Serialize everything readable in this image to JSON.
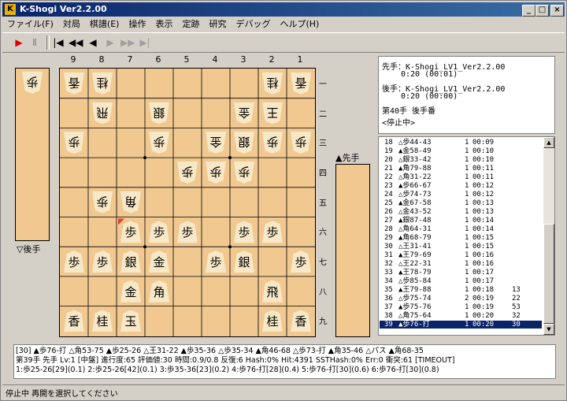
{
  "window": {
    "title": "K-Shogi Ver2.2.00",
    "min": "_",
    "max": "□",
    "close": "×"
  },
  "menu": [
    "ファイル(F)",
    "対局",
    "棋譜(E)",
    "操作",
    "表示",
    "定跡",
    "研究",
    "デバッグ",
    "ヘルプ(H)"
  ],
  "toolbar": {
    "play": "▶",
    "pause": "Ⅱ",
    "first": "|◀",
    "back10": "◀◀",
    "back": "◀",
    "forward": "▶",
    "fwd10": "▶▶",
    "last": "▶|"
  },
  "board": {
    "columns": [
      "9",
      "8",
      "7",
      "6",
      "5",
      "4",
      "3",
      "2",
      "1"
    ],
    "rows": [
      "一",
      "二",
      "三",
      "四",
      "五",
      "六",
      "七",
      "八",
      "九"
    ],
    "pieces": [
      {
        "c": 0,
        "r": 0,
        "p": "香",
        "s": "gote"
      },
      {
        "c": 1,
        "r": 0,
        "p": "桂",
        "s": "gote"
      },
      {
        "c": 7,
        "r": 0,
        "p": "桂",
        "s": "gote"
      },
      {
        "c": 8,
        "r": 0,
        "p": "香",
        "s": "gote"
      },
      {
        "c": 1,
        "r": 1,
        "p": "飛",
        "s": "gote"
      },
      {
        "c": 3,
        "r": 1,
        "p": "銀",
        "s": "gote"
      },
      {
        "c": 6,
        "r": 1,
        "p": "金",
        "s": "gote"
      },
      {
        "c": 7,
        "r": 1,
        "p": "王",
        "s": "gote"
      },
      {
        "c": 0,
        "r": 2,
        "p": "歩",
        "s": "gote"
      },
      {
        "c": 3,
        "r": 2,
        "p": "歩",
        "s": "gote"
      },
      {
        "c": 5,
        "r": 2,
        "p": "金",
        "s": "gote"
      },
      {
        "c": 6,
        "r": 2,
        "p": "銀",
        "s": "gote"
      },
      {
        "c": 7,
        "r": 2,
        "p": "歩",
        "s": "gote"
      },
      {
        "c": 8,
        "r": 2,
        "p": "歩",
        "s": "gote"
      },
      {
        "c": 4,
        "r": 3,
        "p": "歩",
        "s": "gote"
      },
      {
        "c": 5,
        "r": 3,
        "p": "歩",
        "s": "gote"
      },
      {
        "c": 6,
        "r": 3,
        "p": "歩",
        "s": "gote"
      },
      {
        "c": 1,
        "r": 4,
        "p": "歩",
        "s": "gote"
      },
      {
        "c": 2,
        "r": 4,
        "p": "角",
        "s": "gote"
      },
      {
        "c": 2,
        "r": 5,
        "p": "歩",
        "s": "sente"
      },
      {
        "c": 3,
        "r": 5,
        "p": "歩",
        "s": "sente"
      },
      {
        "c": 4,
        "r": 5,
        "p": "歩",
        "s": "sente"
      },
      {
        "c": 6,
        "r": 5,
        "p": "歩",
        "s": "sente"
      },
      {
        "c": 7,
        "r": 5,
        "p": "歩",
        "s": "sente"
      },
      {
        "c": 0,
        "r": 6,
        "p": "歩",
        "s": "sente"
      },
      {
        "c": 1,
        "r": 6,
        "p": "歩",
        "s": "sente"
      },
      {
        "c": 2,
        "r": 6,
        "p": "銀",
        "s": "sente"
      },
      {
        "c": 3,
        "r": 6,
        "p": "金",
        "s": "sente"
      },
      {
        "c": 5,
        "r": 6,
        "p": "歩",
        "s": "sente"
      },
      {
        "c": 6,
        "r": 6,
        "p": "銀",
        "s": "sente"
      },
      {
        "c": 8,
        "r": 6,
        "p": "歩",
        "s": "sente"
      },
      {
        "c": 2,
        "r": 7,
        "p": "金",
        "s": "sente"
      },
      {
        "c": 3,
        "r": 7,
        "p": "角",
        "s": "sente"
      },
      {
        "c": 7,
        "r": 7,
        "p": "飛",
        "s": "sente"
      },
      {
        "c": 0,
        "r": 8,
        "p": "香",
        "s": "sente"
      },
      {
        "c": 1,
        "r": 8,
        "p": "桂",
        "s": "sente"
      },
      {
        "c": 2,
        "r": 8,
        "p": "玉",
        "s": "sente"
      },
      {
        "c": 7,
        "r": 8,
        "p": "桂",
        "s": "sente"
      },
      {
        "c": 8,
        "r": 8,
        "p": "香",
        "s": "sente"
      }
    ],
    "last_move": {
      "c": 2,
      "r": 5
    }
  },
  "gote_hand": {
    "label": "▽後手",
    "pieces": [
      {
        "p": "歩",
        "s": "gote"
      }
    ]
  },
  "sente_hand": {
    "label": "▲先手",
    "pieces": []
  },
  "info": {
    "sente_line": "先手：K-Shogi_LV1_Ver2.2.00",
    "sente_time": "0:20 (00:01)",
    "gote_line": "後手：K-Shogi_LV1_Ver2.2.00",
    "gote_time": "0:20 (00:00)",
    "move_line": "第40手 後手番",
    "state_line": "<停止中>"
  },
  "moves": [
    {
      "n": "18",
      "m": "△歩44-43",
      "d": "1",
      "t": "00:09",
      "x": "",
      "y": ""
    },
    {
      "n": "19",
      "m": "▲金58-49",
      "d": "1",
      "t": "00:10",
      "x": "",
      "y": ""
    },
    {
      "n": "20",
      "m": "△銀33-42",
      "d": "1",
      "t": "00:10",
      "x": "",
      "y": ""
    },
    {
      "n": "21",
      "m": "▲角79-88",
      "d": "1",
      "t": "00:11",
      "x": "",
      "y": ""
    },
    {
      "n": "22",
      "m": "△角31-22",
      "d": "1",
      "t": "00:11",
      "x": "",
      "y": ""
    },
    {
      "n": "23",
      "m": "▲歩66-67",
      "d": "1",
      "t": "00:12",
      "x": "",
      "y": ""
    },
    {
      "n": "24",
      "m": "△歩74-73",
      "d": "1",
      "t": "00:12",
      "x": "",
      "y": ""
    },
    {
      "n": "25",
      "m": "▲金67-58",
      "d": "1",
      "t": "00:13",
      "x": "",
      "y": ""
    },
    {
      "n": "26",
      "m": "△金43-52",
      "d": "1",
      "t": "00:13",
      "x": "",
      "y": ""
    },
    {
      "n": "27",
      "m": "▲銀87-48",
      "d": "1",
      "t": "00:14",
      "x": "",
      "y": ""
    },
    {
      "n": "28",
      "m": "△角64-31",
      "d": "1",
      "t": "00:14",
      "x": "",
      "y": ""
    },
    {
      "n": "29",
      "m": "▲角68-79",
      "d": "1",
      "t": "00:15",
      "x": "",
      "y": ""
    },
    {
      "n": "30",
      "m": "△王31-41",
      "d": "1",
      "t": "00:15",
      "x": "",
      "y": ""
    },
    {
      "n": "31",
      "m": "▲王79-69",
      "d": "1",
      "t": "00:16",
      "x": "",
      "y": ""
    },
    {
      "n": "32",
      "m": "△王22-31",
      "d": "1",
      "t": "00:16",
      "x": "",
      "y": ""
    },
    {
      "n": "33",
      "m": "▲王78-79",
      "d": "1",
      "t": "00:17",
      "x": "",
      "y": ""
    },
    {
      "n": "34",
      "m": "△歩85-84",
      "d": "1",
      "t": "00:17",
      "x": "",
      "y": ""
    },
    {
      "n": "35",
      "m": "▲王79-88",
      "d": "1",
      "t": "00:18",
      "x": "13",
      "y": ""
    },
    {
      "n": "36",
      "m": "△歩75-74",
      "d": "2",
      "t": "00:19",
      "x": "22",
      "y": ""
    },
    {
      "n": "37",
      "m": "▲歩75-76",
      "d": "1",
      "t": "00:19",
      "x": "53",
      "y": ""
    },
    {
      "n": "38",
      "m": "△角75-64",
      "d": "1",
      "t": "00:20",
      "x": "32",
      "y": ""
    },
    {
      "n": "39",
      "m": "▲歩76-打",
      "d": "1",
      "t": "00:20",
      "x": "30",
      "y": ""
    }
  ],
  "analysis": {
    "line1": "[30] ▲歩76-打 △角53-75 ▲歩25-26 △王31-22 ▲歩35-36 △歩35-34 ▲角46-68 △歩73-打 ▲角35-46 △パス ▲角68-35",
    "line2": "第39手 先手 Lv:1 [中盤] 進行度:65 評価値:30 時間:0.9/0.8 反復:6 Hash:0% Hit:4391 SSTHash:0% Err:0 衝突:61 [TIMEOUT]",
    "line3": "1:歩25-26[29](0.1) 2:歩25-26[42](0.1) 3:歩35-36[23](0.2) 4:歩76-打[28](0.4) 5:歩76-打[30](0.6) 6:歩76-打[30](0.8)"
  },
  "status": "停止中 再開を選択してください",
  "colors": {
    "board": "#f0c890",
    "piece": "#f7e8c8",
    "selection": "#0a246a",
    "title_start": "#0a246a",
    "title_end": "#3a6ea5"
  }
}
